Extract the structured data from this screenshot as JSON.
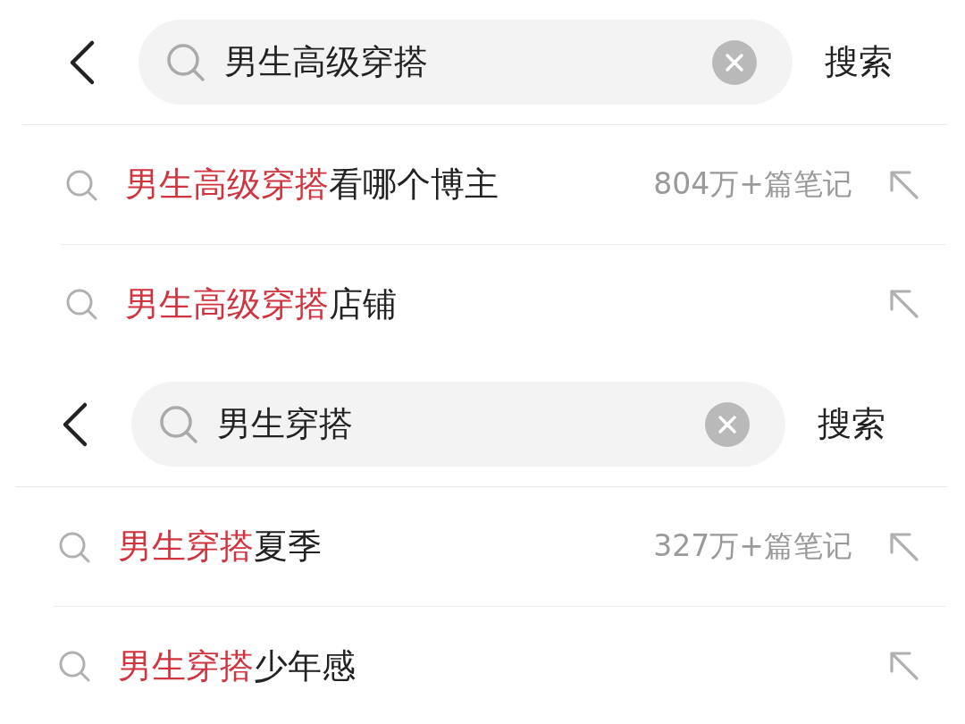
{
  "panels": [
    {
      "query": "男生高级穿搭",
      "search_button": "搜索",
      "suggestions": [
        {
          "match": "男生高级穿搭",
          "rest": "看哪个博主",
          "count": "804万+篇笔记"
        },
        {
          "match": "男生高级穿搭",
          "rest": "店铺"
        }
      ]
    },
    {
      "query": "男生穿搭",
      "search_button": "搜索",
      "suggestions": [
        {
          "match": "男生穿搭",
          "rest": "夏季",
          "count": "327万+篇笔记"
        },
        {
          "match": "男生穿搭",
          "rest": "少年感"
        }
      ]
    }
  ]
}
